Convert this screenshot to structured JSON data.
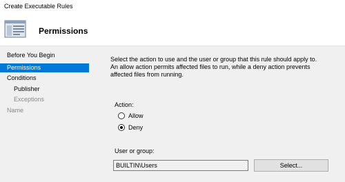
{
  "window": {
    "title": "Create Executable Rules"
  },
  "banner": {
    "icon": "wizard-page-icon",
    "title": "Permissions"
  },
  "sidebar": {
    "items": [
      {
        "label": "Before You Begin",
        "state": "normal"
      },
      {
        "label": "Permissions",
        "state": "selected"
      },
      {
        "label": "Conditions",
        "state": "normal"
      },
      {
        "label": "Publisher",
        "state": "normal"
      },
      {
        "label": "Exceptions",
        "state": "disabled"
      },
      {
        "label": "Name",
        "state": "disabled"
      }
    ]
  },
  "main": {
    "description": "Select the action to use and the user or group that this rule should apply to. An allow action permits affected files to run, while a deny action prevents affected files from running.",
    "action": {
      "label": "Action:",
      "options": [
        {
          "label": "Allow",
          "selected": false
        },
        {
          "label": "Deny",
          "selected": true
        }
      ]
    },
    "user_group": {
      "label": "User or group:",
      "value": "BUILTIN\\Users",
      "select_label": "Select..."
    }
  },
  "colors": {
    "accent": "#0078d7",
    "panel": "#f0f0f0"
  }
}
